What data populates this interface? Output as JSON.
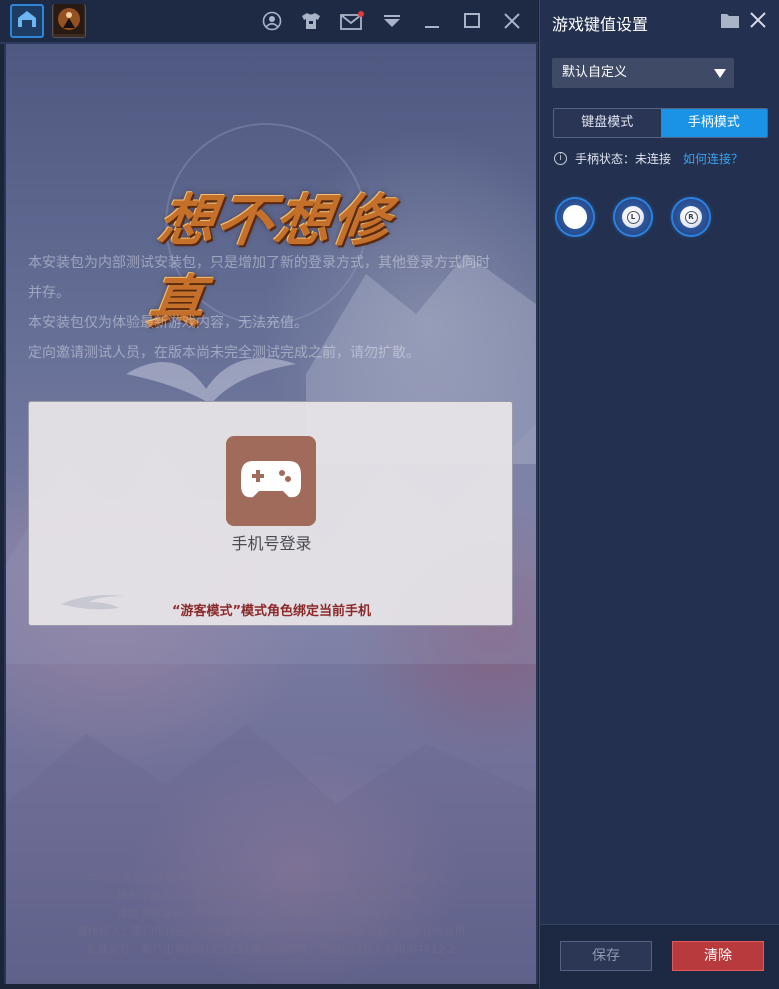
{
  "tabs": [
    {
      "name": "home",
      "icon": "home-icon"
    },
    {
      "name": "game",
      "icon": "game-avatar-icon"
    }
  ],
  "toolbar": {
    "icons": [
      "account-icon",
      "tshirt-icon",
      "mail-icon",
      "dropdown-icon",
      "minimize-icon",
      "maximize-icon",
      "close-icon"
    ],
    "mail_badge_color": "#e03b3b"
  },
  "game": {
    "logo_text": "想不想修真",
    "notices": [
      "本安装包为内部测试安装包，只是增加了新的登录方式，其他登录方式同时",
      "并存。",
      "本安装包仅为体验最新游戏内容，无法充值。",
      "定向邀请测试人员，在版本尚未完全测试完成之前，请勿扩散。"
    ],
    "phone_login_label": "手机号登录",
    "guest_note": "“游客模式”模式角色绑定当前手机",
    "footer": [
      "本网络游戏适合年满16岁以上用户，为了您的健康，请合理控制游戏时间。",
      "抵制不良游戏，拒绝盗版游戏，注意自我保护，谨防受骗上当。",
      "适度游戏益脑，沉迷游戏伤身，合理安排时间，享受健康生活。",
      "著作权人：厦门市行云文化传播有限公司   出版单位：湖北长江数字出版有限公司",
      "批准文号：新广出审[2018]1232号   出版物号：ISBN 978-7-498-04612-2"
    ]
  },
  "panel": {
    "title": "游戏键值设置",
    "profile": "默认自定义",
    "mode_tabs": [
      {
        "label": "键盘模式",
        "active": false
      },
      {
        "label": "手柄模式",
        "active": true
      }
    ],
    "status_text": "手柄状态：未连接",
    "connect_link": "如何连接？",
    "joystick_buttons": [
      {
        "name": "joystick-blank",
        "label": ""
      },
      {
        "name": "joystick-l",
        "label": "L"
      },
      {
        "name": "joystick-r",
        "label": "R"
      }
    ],
    "save_label": "保存",
    "clear_label": "清除",
    "accent_color": "#1a93e6",
    "danger_color": "#b83a3c"
  }
}
